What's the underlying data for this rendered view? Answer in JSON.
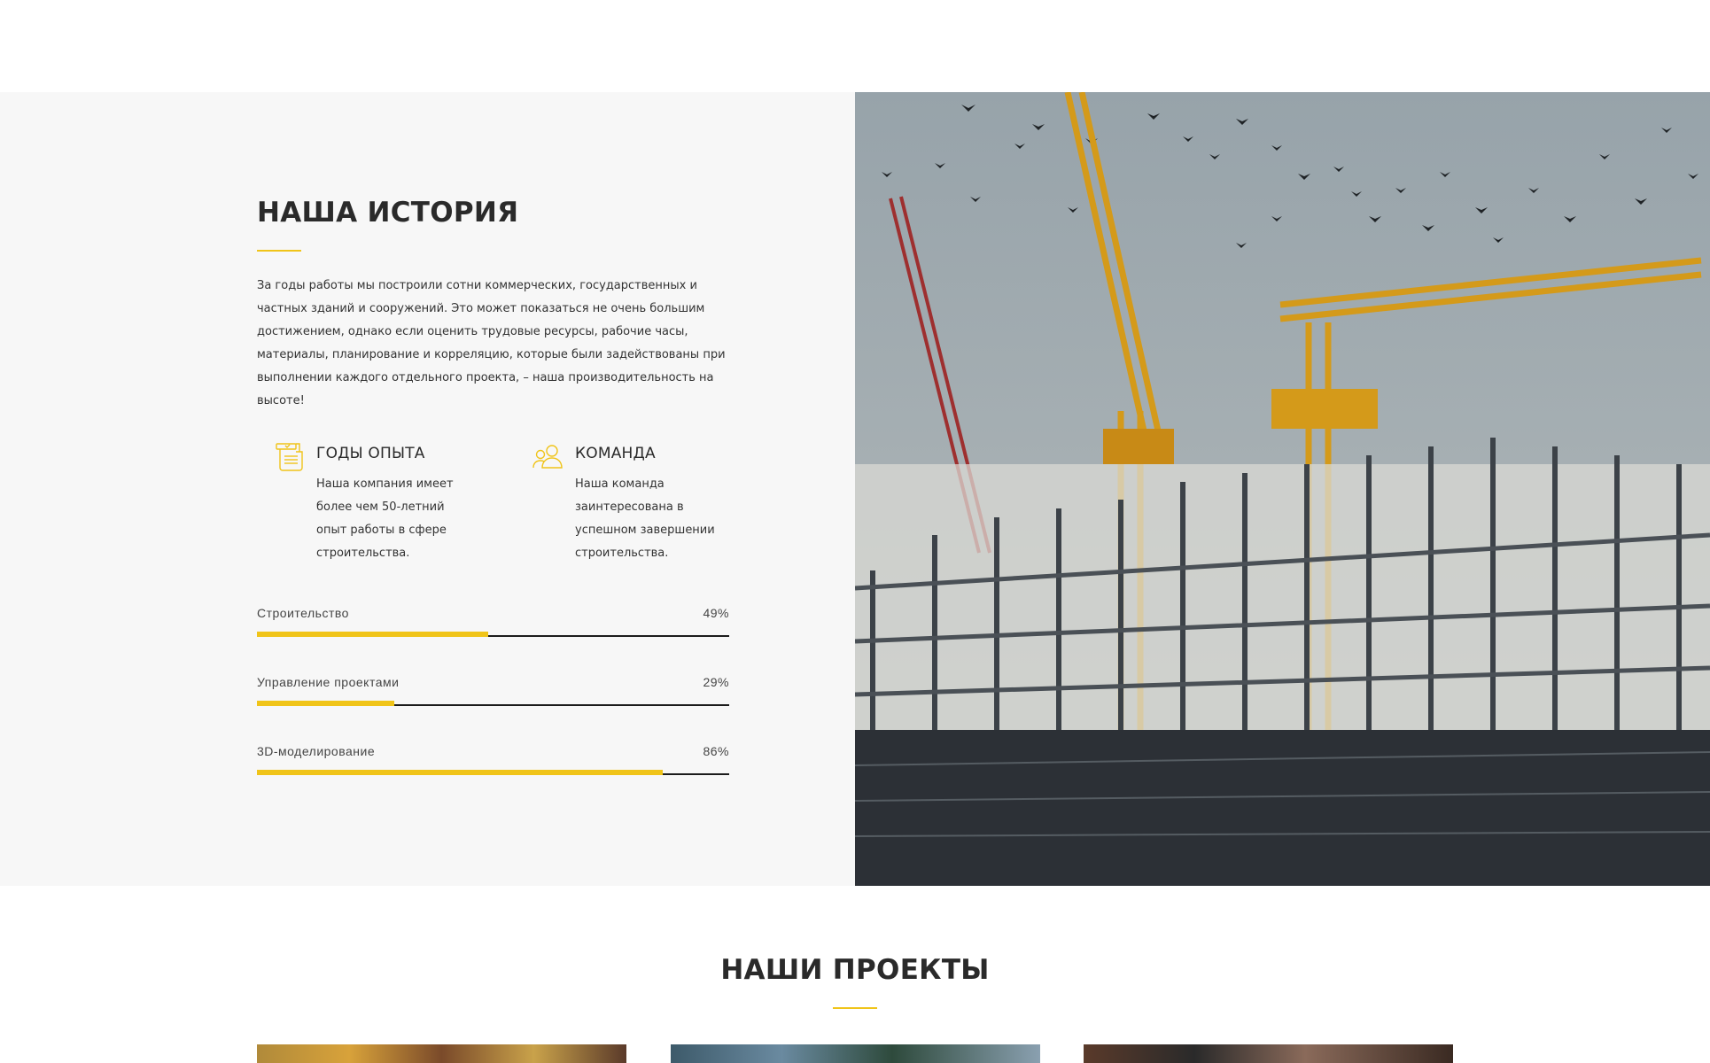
{
  "history": {
    "title": "НАША ИСТОРИЯ",
    "text": "За годы работы мы построили сотни коммерческих, государственных и частных зданий и сооружений. Это может показаться не очень большим достижением, однако если оценить трудовые ресурсы, рабочие часы, материалы, планирование и корреляцию, которые были задействованы при выполнении каждого отдельного проекта, – наша производительность на высоте!",
    "features": [
      {
        "icon": "scroll-icon",
        "title": "ГОДЫ ОПЫТА",
        "text": "Наша компания имеет более чем 50-летний опыт работы в сфере строительства."
      },
      {
        "icon": "team-icon",
        "title": "КОМАНДА",
        "text": "Наша команда заинтересована в успешном завершении строительства."
      }
    ],
    "skills": [
      {
        "label": "Строительство",
        "value": "49%",
        "fraction": 0.49
      },
      {
        "label": "Управление проектами",
        "value": "29%",
        "fraction": 0.29
      },
      {
        "label": "3D-моделирование",
        "value": "86%",
        "fraction": 0.86
      }
    ],
    "image": "construction-cranes-photo"
  },
  "projects": {
    "title": "НАШИ ПРОЕКТЫ",
    "cards": [
      {
        "image": "project-1-photo"
      },
      {
        "image": "project-2-photo"
      },
      {
        "image": "project-3-photo"
      }
    ]
  },
  "colors": {
    "accent": "#f0c419",
    "panel": "#f7f7f7",
    "text": "#2a2a2a"
  }
}
